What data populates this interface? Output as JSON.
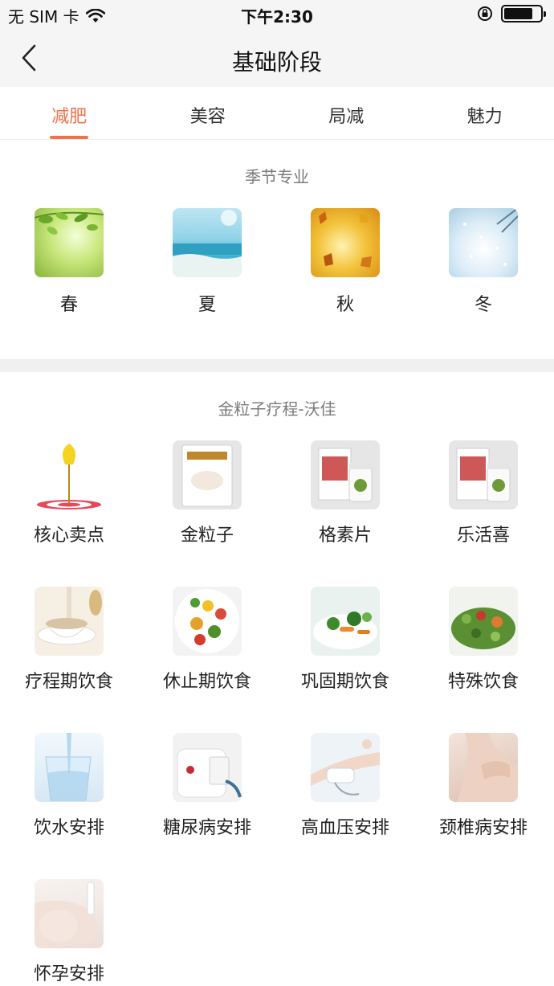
{
  "status_bar": {
    "carrier": "无 SIM 卡",
    "time": "下午2:30",
    "battery_level": 0.8
  },
  "nav": {
    "title": "基础阶段"
  },
  "tabs": [
    {
      "label": "减肥",
      "active": true
    },
    {
      "label": "美容",
      "active": false
    },
    {
      "label": "局减",
      "active": false
    },
    {
      "label": "魅力",
      "active": false
    }
  ],
  "season_section": {
    "title": "季节专业",
    "items": [
      {
        "label": "春",
        "icon": "spring-leaves-image"
      },
      {
        "label": "夏",
        "icon": "summer-sea-image"
      },
      {
        "label": "秋",
        "icon": "autumn-leaves-image"
      },
      {
        "label": "冬",
        "icon": "winter-snow-image"
      }
    ]
  },
  "course_section": {
    "title": "金粒子疗程-沃佳",
    "items": [
      {
        "label": "核心卖点",
        "icon": "dart-target-image"
      },
      {
        "label": "金粒子",
        "icon": "product-package-image"
      },
      {
        "label": "格素片",
        "icon": "product-bottle-image"
      },
      {
        "label": "乐活喜",
        "icon": "product-bottle-image"
      },
      {
        "label": "疗程期饮食",
        "icon": "oatmeal-bowl-image"
      },
      {
        "label": "休止期饮食",
        "icon": "salad-plate-image"
      },
      {
        "label": "巩固期饮食",
        "icon": "vegetable-bowl-image"
      },
      {
        "label": "特殊饮食",
        "icon": "green-salad-image"
      },
      {
        "label": "饮水安排",
        "icon": "water-glass-image"
      },
      {
        "label": "糖尿病安排",
        "icon": "glucose-meter-image"
      },
      {
        "label": "高血压安排",
        "icon": "blood-pressure-image"
      },
      {
        "label": "颈椎病安排",
        "icon": "neck-shoulder-image"
      },
      {
        "label": "怀孕安排",
        "icon": "pregnancy-image"
      }
    ]
  },
  "colors": {
    "accent": "#f0724a",
    "header_bg": "#f5f5f5",
    "divider": "#f0f0f0"
  }
}
